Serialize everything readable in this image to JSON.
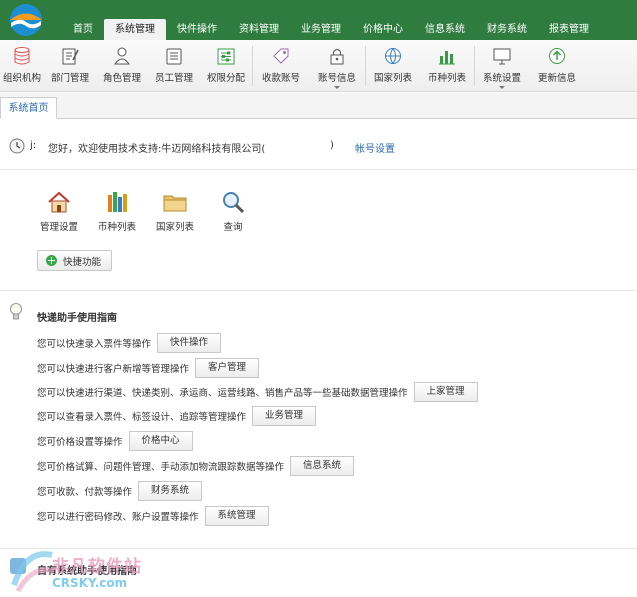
{
  "nav": {
    "items": [
      "首页",
      "系统管理",
      "快件操作",
      "资料管理",
      "业务管理",
      "价格中心",
      "信息系统",
      "财务系统",
      "报表管理"
    ],
    "active_index": 1
  },
  "toolbar": {
    "items": [
      {
        "label": "组织机构",
        "icon": "database-icon",
        "dropdown": false
      },
      {
        "label": "部门管理",
        "icon": "edit-doc-icon",
        "dropdown": false
      },
      {
        "label": "角色管理",
        "icon": "user-icon",
        "dropdown": false
      },
      {
        "label": "员工管理",
        "icon": "staff-icon",
        "dropdown": false
      },
      {
        "label": "权限分配",
        "icon": "sliders-icon",
        "dropdown": false
      },
      {
        "label": "收款账号",
        "icon": "tag-icon",
        "dropdown": false
      },
      {
        "label": "账号信息",
        "icon": "lock-icon",
        "dropdown": true
      },
      {
        "label": "国家列表",
        "icon": "globe-icon",
        "dropdown": false
      },
      {
        "label": "币种列表",
        "icon": "bar-chart-icon",
        "dropdown": false
      },
      {
        "label": "系统设置",
        "icon": "monitor-icon",
        "dropdown": true
      },
      {
        "label": "更新信息",
        "icon": "upload-icon",
        "dropdown": false
      }
    ]
  },
  "tab": {
    "label": "系统首页"
  },
  "welcome": {
    "user": "j:",
    "text": "您好，欢迎使用技术支持:牛迈网络科技有限公司(",
    "suffix": ")",
    "account_link": "帐号设置"
  },
  "shortcuts": {
    "items": [
      {
        "label": "管理设置",
        "icon": "home-icon"
      },
      {
        "label": "币种列表",
        "icon": "books-icon"
      },
      {
        "label": "国家列表",
        "icon": "folder-icon"
      },
      {
        "label": "查询",
        "icon": "magnifier-icon"
      }
    ],
    "quick_button": "快捷功能"
  },
  "guide": {
    "title": "快递助手使用指南",
    "rows": [
      {
        "text": "您可以快速录入票件等操作",
        "button": "快件操作"
      },
      {
        "text": "您可以快速进行客户新增等管理操作",
        "button": "客户管理"
      },
      {
        "text": "您可以快速进行渠道、快递类别、承运商、运营线路、销售产品等一些基础数据管理操作",
        "button": "上家管理"
      },
      {
        "text": "您可以查看录入票件、标签设计、追踪等管理操作",
        "button": "业务管理"
      },
      {
        "text": "您可价格设置等操作",
        "button": "价格中心"
      },
      {
        "text": "您可价格试算、问题件管理、手动添加物流跟踪数据等操作",
        "button": "信息系统"
      },
      {
        "text": "您可收款、付款等操作",
        "button": "财务系统"
      },
      {
        "text": "您可以进行密码修改、账户设置等操作",
        "button": "系统管理"
      }
    ]
  },
  "footer": {
    "title": "自有系统助手使用指南"
  },
  "watermark": {
    "cn": "非凡软件站",
    "en": "CRSKY.com"
  }
}
